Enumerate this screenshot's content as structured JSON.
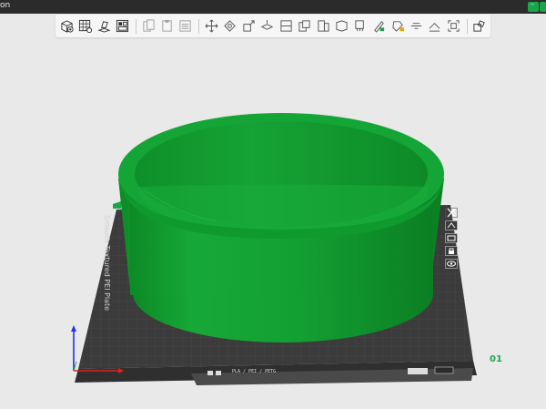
{
  "app": {
    "title_fragment": "on"
  },
  "toolbar": {
    "groups": [
      [
        "add-object-icon",
        "add-plate-icon",
        "auto-orient-icon",
        "arrange-icon"
      ],
      [
        "copy-icon",
        "paste-icon",
        "delete-icon"
      ],
      [
        "move-icon",
        "rotate-icon",
        "scale-icon",
        "lay-on-face-icon",
        "cut-icon",
        "split-objects-icon",
        "split-parts-icon",
        "variable-layer-height-icon",
        "support-painting-icon",
        "seam-painting-icon",
        "color-painting-icon",
        "text-emboss-icon",
        "measure-icon"
      ],
      [
        "assembly-view-icon"
      ]
    ]
  },
  "side_toolbar": [
    "close-icon",
    "orient-icon",
    "layout-icon",
    "lock-icon",
    "view-icon"
  ],
  "plate": {
    "number": "01",
    "footer_text": "PLA / PEI / PETG",
    "side_label": "Smooth Textured PEI Plate"
  },
  "colors": {
    "model": "#12a133",
    "model_dark": "#0a7a22",
    "plate": "#3a3a3a",
    "accent": "#19a64a",
    "background": "#e9e9e9"
  }
}
